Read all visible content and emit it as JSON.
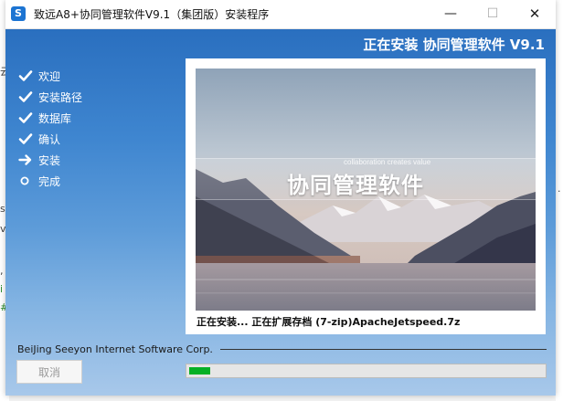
{
  "window": {
    "title": "致远A8+协同管理软件V9.1（集团版）安装程序",
    "icon": "seeyon-app-icon"
  },
  "header": {
    "title": "正在安装 协同管理软件 V9.1"
  },
  "steps": [
    {
      "label": "欢迎",
      "state": "done",
      "icon": "check-icon"
    },
    {
      "label": "安装路径",
      "state": "done",
      "icon": "check-icon"
    },
    {
      "label": "数据库",
      "state": "done",
      "icon": "check-icon"
    },
    {
      "label": "确认",
      "state": "done",
      "icon": "check-icon"
    },
    {
      "label": "安装",
      "state": "current",
      "icon": "arrow-right-icon"
    },
    {
      "label": "完成",
      "state": "pending",
      "icon": "circle-icon"
    }
  ],
  "banner": {
    "tagline": "collaboration creates value",
    "caption": "协同管理软件"
  },
  "status": {
    "text": "正在安装... 正在扩展存档 (7-zip)ApacheJetspeed.7z"
  },
  "footer": {
    "company": "BeiJing Seeyon Internet Software Corp.",
    "cancel_label": "取消"
  },
  "progress": {
    "value": 0.06
  },
  "colors": {
    "accent": "#2a6fbf",
    "progress_fill": "#06b025"
  }
}
